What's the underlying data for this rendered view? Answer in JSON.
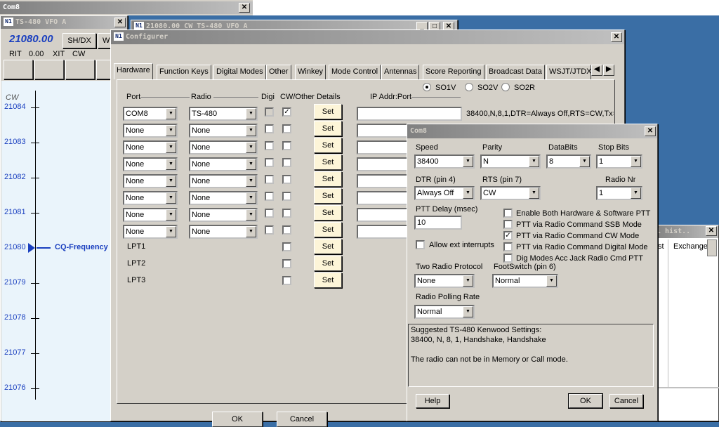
{
  "top": {
    "title": "Com8"
  },
  "vfo": {
    "title": "TS-480 VFO A",
    "freq": "21080.00",
    "shdx": "SH/DX",
    "w": "W",
    "rit": "RIT",
    "rit_val": "0.00",
    "xit": "XIT",
    "cw": "CW"
  },
  "band": {
    "mode": "CW",
    "freqs": [
      "21084",
      "21083",
      "21082",
      "21081",
      "21080",
      "21079",
      "21078",
      "21077",
      "21076"
    ],
    "cq": "CQ-Frequency"
  },
  "bwin": {
    "title": "21080.00 CW TS-480 VFO A"
  },
  "config": {
    "title": "Configurer",
    "tabs": [
      "Hardware",
      "Function Keys",
      "Digital Modes",
      "Other",
      "Winkey",
      "Mode Control",
      "Antennas",
      "Score Reporting",
      "Broadcast Data",
      "WSJT/JTDX"
    ],
    "so": [
      "SO1V",
      "SO2V",
      "SO2R"
    ],
    "headers": {
      "port": "Port",
      "radio": "Radio",
      "digi": "Digi",
      "cw": "CW/Other",
      "details": "Details",
      "ip": "IP Addr:Port"
    },
    "rows": [
      {
        "port": "COM8",
        "radio": "TS-480",
        "cw": true
      },
      {
        "port": "None",
        "radio": "None"
      },
      {
        "port": "None",
        "radio": "None"
      },
      {
        "port": "None",
        "radio": "None"
      },
      {
        "port": "None",
        "radio": "None"
      },
      {
        "port": "None",
        "radio": "None"
      },
      {
        "port": "None",
        "radio": "None"
      },
      {
        "port": "None",
        "radio": "None"
      }
    ],
    "lpt": [
      "LPT1",
      "LPT2",
      "LPT3"
    ],
    "set": "Set",
    "status": "38400,N,8,1,DTR=Always Off,RTS=CW,Tx=",
    "ok": "OK",
    "cancel": "Cancel"
  },
  "com8": {
    "title": "Com8",
    "speed_l": "Speed",
    "speed": "38400",
    "parity_l": "Parity",
    "parity": "N",
    "databits_l": "DataBits",
    "databits": "8",
    "stop_l": "Stop Bits",
    "stop": "1",
    "dtr_l": "DTR (pin 4)",
    "dtr": "Always Off",
    "rts_l": "RTS (pin 7)",
    "rts": "CW",
    "nr_l": "Radio Nr",
    "nr": "1",
    "delay_l": "PTT Delay  (msec)",
    "delay": "10",
    "allow": "Allow ext interrupts",
    "ptt": [
      "Enable Both Hardware & Software PTT",
      "PTT via Radio Command SSB Mode",
      "PTT via Radio Command CW Mode",
      "PTT via Radio Command Digital Mode",
      "Dig Modes Acc Jack Radio Cmd PTT"
    ],
    "two_l": "Two Radio Protocol",
    "two": "None",
    "foot_l": "FootSwitch (pin 6)",
    "foot": "Normal",
    "poll_l": "Radio Polling Rate",
    "poll": "Normal",
    "suggest": [
      "Suggested TS-480 Kenwood Settings:",
      "38400, N, 8, 1, Handshake, Handshake",
      "",
      "The radio can not be in Memory or Call mode."
    ],
    "help": "Help",
    "ok": "OK",
    "cancel": "Cancel"
  },
  "hist": {
    "title": "l hist..",
    "col1": "st",
    "col2": "Exchange"
  }
}
